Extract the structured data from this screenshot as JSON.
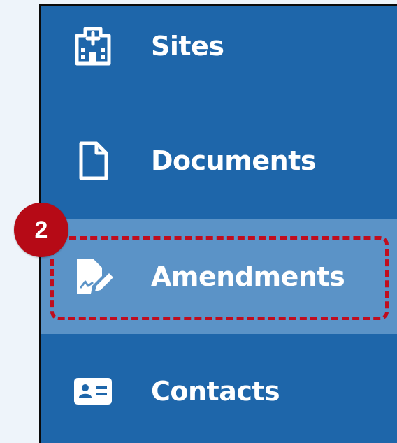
{
  "sidebar": {
    "items": [
      {
        "label": "Sites",
        "icon": "hospital-building-icon"
      },
      {
        "label": "Documents",
        "icon": "document-icon"
      },
      {
        "label": "Amendments",
        "icon": "file-signature-icon",
        "highlighted": true
      },
      {
        "label": "Contacts",
        "icon": "contact-card-icon"
      }
    ]
  },
  "annotation": {
    "step_number": "2"
  },
  "colors": {
    "sidebar_bg": "#1e66aa",
    "active_item_bg": "#5b93c7",
    "page_bg": "#eef4fa",
    "highlight_red": "#c00d1e",
    "text": "#ffffff"
  }
}
